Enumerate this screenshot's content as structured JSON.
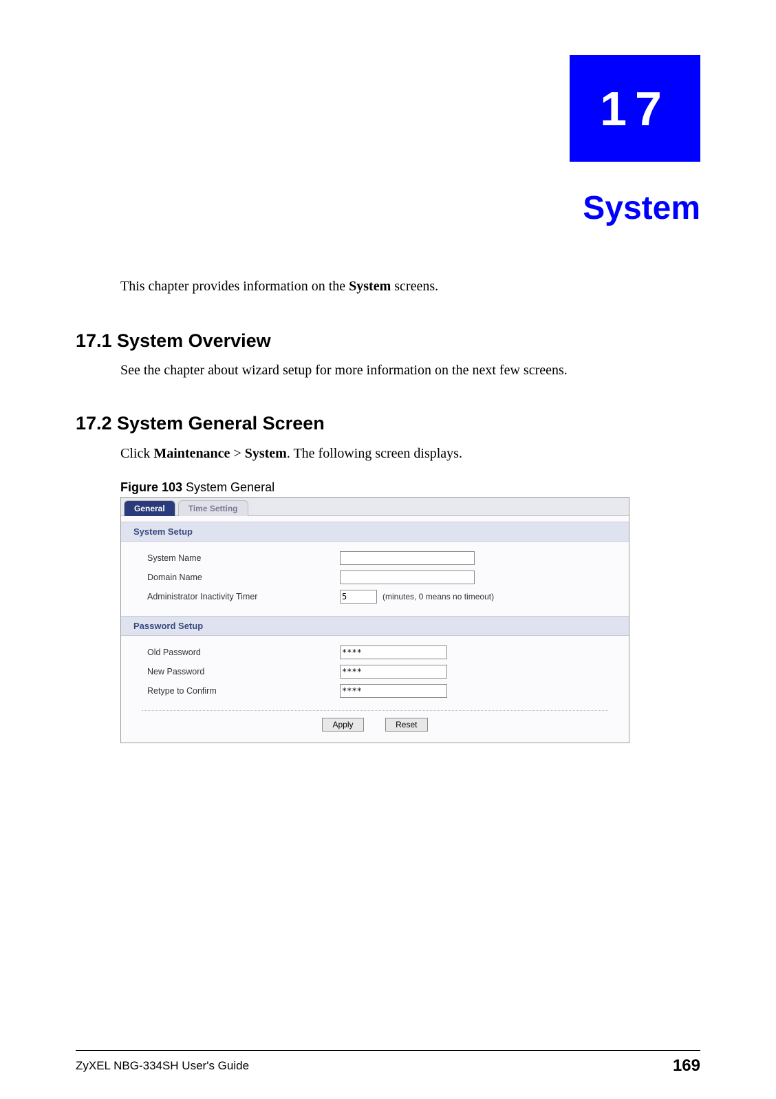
{
  "chapter": {
    "number": "17",
    "title": "System"
  },
  "intro": {
    "prefix": "This chapter provides information on the ",
    "bold": "System",
    "suffix": " screens."
  },
  "section1": {
    "heading": "17.1  System Overview",
    "body": "See the chapter about wizard setup for more information on the next few screens."
  },
  "section2": {
    "heading": "17.2  System General Screen",
    "body_pre": "Click ",
    "body_b1": "Maintenance",
    "body_sep": " > ",
    "body_b2": "System",
    "body_post": ". The following screen displays."
  },
  "figure": {
    "num": "Figure 103",
    "caption": "   System General"
  },
  "ui": {
    "tabs": {
      "general": "General",
      "time": "Time Setting"
    },
    "system_setup": {
      "header": "System Setup",
      "system_name_label": "System Name",
      "system_name_value": "",
      "domain_name_label": "Domain Name",
      "domain_name_value": "",
      "admin_timer_label": "Administrator Inactivity Timer",
      "admin_timer_value": "5",
      "admin_timer_hint": "(minutes, 0 means no timeout)"
    },
    "password_setup": {
      "header": "Password Setup",
      "old_label": "Old Password",
      "old_value": "****",
      "new_label": "New Password",
      "new_value": "****",
      "retype_label": "Retype to Confirm",
      "retype_value": "****"
    },
    "buttons": {
      "apply": "Apply",
      "reset": "Reset"
    }
  },
  "footer": {
    "left": "ZyXEL NBG-334SH User's Guide",
    "right": "169"
  }
}
